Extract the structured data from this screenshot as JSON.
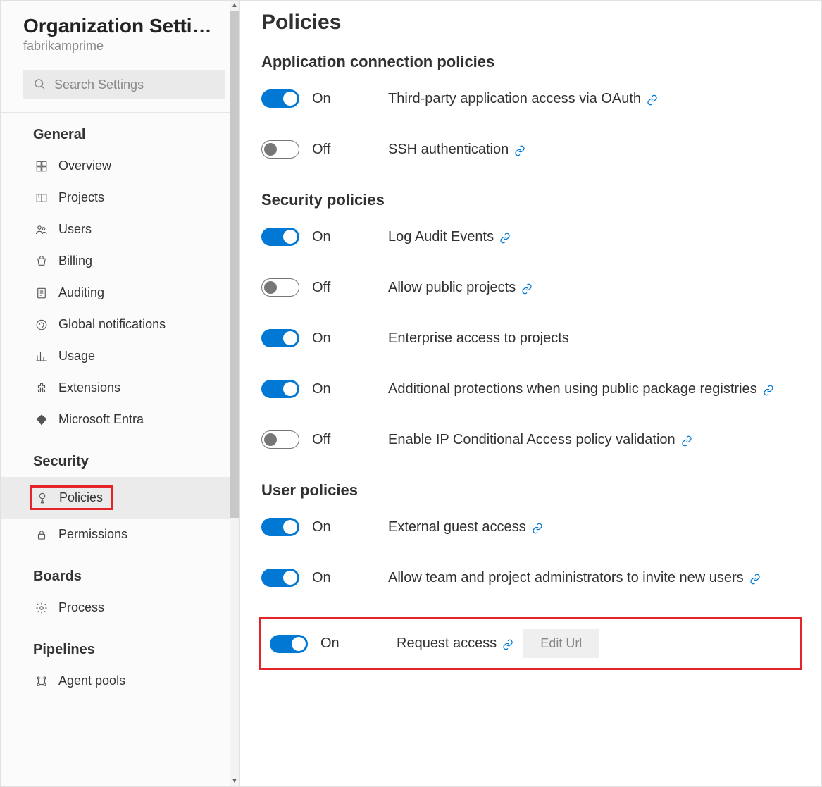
{
  "sidebar": {
    "title": "Organization Settin...",
    "subtitle": "fabrikamprime",
    "search_placeholder": "Search Settings",
    "sections": [
      {
        "heading": "General",
        "items": [
          {
            "id": "overview",
            "label": "Overview",
            "icon": "overview-icon"
          },
          {
            "id": "projects",
            "label": "Projects",
            "icon": "projects-icon"
          },
          {
            "id": "users",
            "label": "Users",
            "icon": "users-icon"
          },
          {
            "id": "billing",
            "label": "Billing",
            "icon": "billing-icon"
          },
          {
            "id": "auditing",
            "label": "Auditing",
            "icon": "auditing-icon"
          },
          {
            "id": "global-notifications",
            "label": "Global notifications",
            "icon": "notifications-icon"
          },
          {
            "id": "usage",
            "label": "Usage",
            "icon": "usage-icon"
          },
          {
            "id": "extensions",
            "label": "Extensions",
            "icon": "extensions-icon"
          },
          {
            "id": "microsoft-entra",
            "label": "Microsoft Entra",
            "icon": "entra-icon"
          }
        ]
      },
      {
        "heading": "Security",
        "items": [
          {
            "id": "policies",
            "label": "Policies",
            "icon": "policies-icon",
            "active": true,
            "highlight": true
          },
          {
            "id": "permissions",
            "label": "Permissions",
            "icon": "permissions-icon"
          }
        ]
      },
      {
        "heading": "Boards",
        "items": [
          {
            "id": "process",
            "label": "Process",
            "icon": "process-icon"
          }
        ]
      },
      {
        "heading": "Pipelines",
        "items": [
          {
            "id": "agent-pools",
            "label": "Agent pools",
            "icon": "agent-pools-icon"
          }
        ]
      }
    ]
  },
  "main": {
    "title": "Policies",
    "toggle_labels": {
      "on": "On",
      "off": "Off"
    },
    "edit_url_label": "Edit Url",
    "groups": [
      {
        "title": "Application connection policies",
        "policies": [
          {
            "id": "oauth",
            "label": "Third-party application access via OAuth",
            "on": true,
            "link": true
          },
          {
            "id": "ssh",
            "label": "SSH authentication",
            "on": false,
            "link": true
          }
        ]
      },
      {
        "title": "Security policies",
        "policies": [
          {
            "id": "audit",
            "label": "Log Audit Events",
            "on": true,
            "link": true
          },
          {
            "id": "public-projects",
            "label": "Allow public projects",
            "on": false,
            "link": true
          },
          {
            "id": "enterprise-access",
            "label": "Enterprise access to projects",
            "on": true,
            "link": false
          },
          {
            "id": "public-registries",
            "label": "Additional protections when using public package registries",
            "on": true,
            "link": true
          },
          {
            "id": "ip-cap",
            "label": "Enable IP Conditional Access policy validation",
            "on": false,
            "link": true
          }
        ]
      },
      {
        "title": "User policies",
        "policies": [
          {
            "id": "guest-access",
            "label": "External guest access",
            "on": true,
            "link": true
          },
          {
            "id": "invite-users",
            "label": "Allow team and project administrators to invite new users",
            "on": true,
            "link": true
          },
          {
            "id": "request-access",
            "label": "Request access",
            "on": true,
            "link": true,
            "highlight": true,
            "edit_url": true
          }
        ]
      }
    ]
  }
}
